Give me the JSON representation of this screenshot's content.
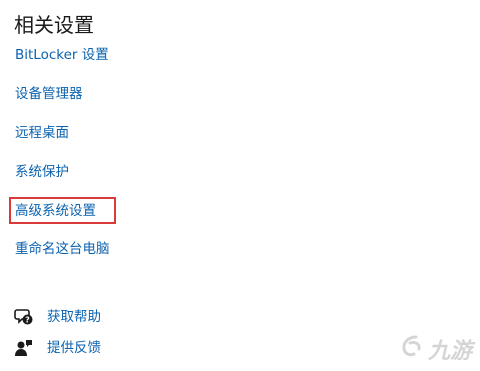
{
  "section": {
    "title": "相关设置"
  },
  "links": [
    {
      "label": "BitLocker 设置"
    },
    {
      "label": "设备管理器"
    },
    {
      "label": "远程桌面"
    },
    {
      "label": "系统保护"
    },
    {
      "label": "高级系统设置"
    },
    {
      "label": "重命名这台电脑"
    }
  ],
  "help": {
    "get_help_label": "获取帮助",
    "feedback_label": "提供反馈"
  },
  "watermark": {
    "text": "九游"
  },
  "colors": {
    "link": "#0b63b0",
    "highlight": "#d93a3a",
    "title": "#1a1a1a"
  },
  "icons": {
    "get_help": "chat-help-icon",
    "feedback": "feedback-person-icon"
  }
}
